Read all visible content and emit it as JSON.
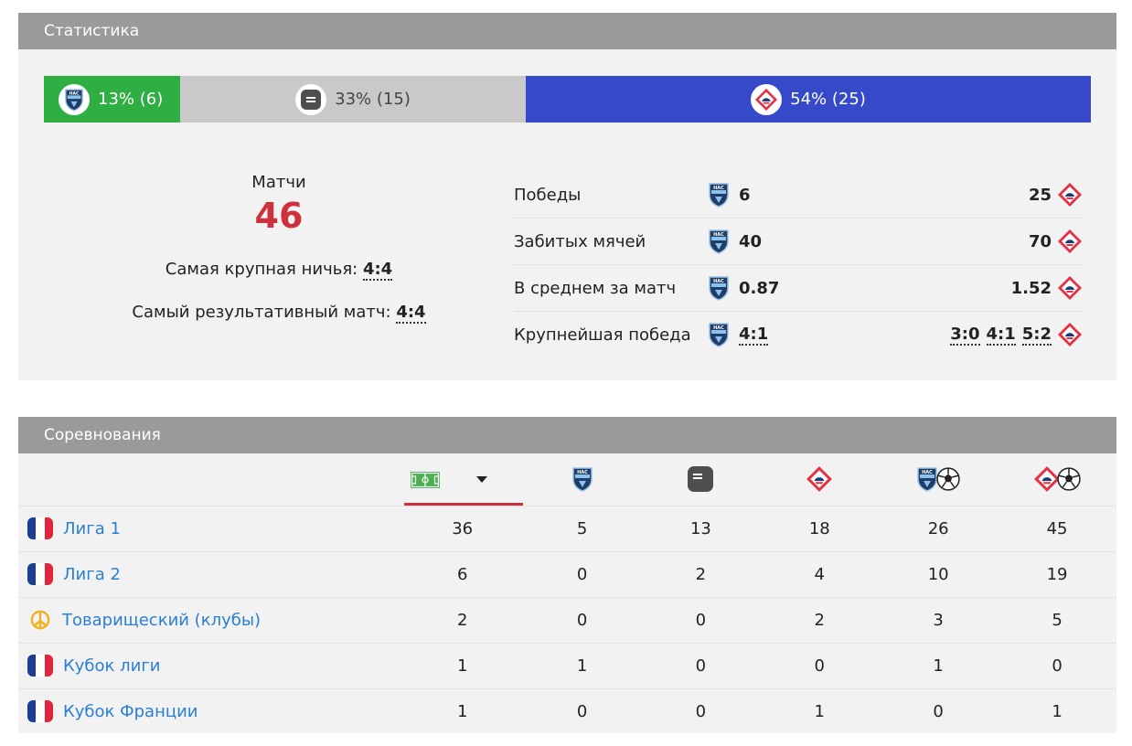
{
  "stats": {
    "title": "Статистика",
    "distribution": {
      "home": "13% (6)",
      "draw": "33% (15)",
      "away": "54% (25)"
    },
    "matches_label": "Матчи",
    "matches_count": "46",
    "biggest_draw_label": "Самая крупная ничья:",
    "biggest_draw_value": "4:4",
    "highest_scoring_label": "Самый результативный матч:",
    "highest_scoring_value": "4:4",
    "rows": [
      {
        "label": "Победы",
        "home": "6",
        "away": [
          "25"
        ]
      },
      {
        "label": "Забитых мячей",
        "home": "40",
        "away": [
          "70"
        ]
      },
      {
        "label": "В среднем за матч",
        "home": "0.87",
        "away": [
          "1.52"
        ]
      },
      {
        "label": "Крупнейшая победа",
        "home": "4:1",
        "away": [
          "3:0",
          "4:1",
          "5:2"
        ]
      }
    ]
  },
  "competitions": {
    "title": "Соревнования",
    "columns": [
      "matches-icon",
      "home-wins-icon",
      "draws-icon",
      "away-wins-icon",
      "home-goals-icon",
      "away-goals-icon"
    ],
    "rows": [
      {
        "name": "Лига 1",
        "flag": "france",
        "values": [
          "36",
          "5",
          "13",
          "18",
          "26",
          "45"
        ]
      },
      {
        "name": "Лига 2",
        "flag": "france",
        "values": [
          "6",
          "0",
          "2",
          "4",
          "10",
          "19"
        ]
      },
      {
        "name": "Товарищеский (клубы)",
        "flag": "peace",
        "values": [
          "2",
          "0",
          "0",
          "2",
          "3",
          "5"
        ]
      },
      {
        "name": "Кубок лиги",
        "flag": "france",
        "values": [
          "1",
          "1",
          "0",
          "0",
          "1",
          "0"
        ]
      },
      {
        "name": "Кубок Франции",
        "flag": "france",
        "values": [
          "1",
          "0",
          "0",
          "1",
          "0",
          "1"
        ]
      }
    ]
  },
  "colors": {
    "home": "#2fae43",
    "draw": "#c9c9c9",
    "away": "#3549c9",
    "accent": "#d0303b",
    "link": "#2a7fd4",
    "header": "#9a9a9a"
  }
}
